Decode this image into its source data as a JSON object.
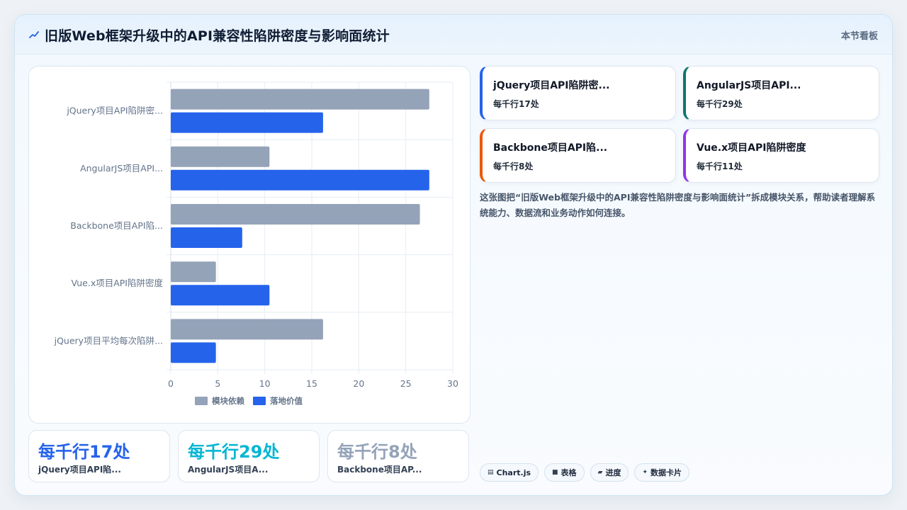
{
  "header": {
    "title": "旧版Web框架升级中的API兼容性陷阱密度与影响面统计",
    "right_label": "本节看板"
  },
  "chart_data": {
    "type": "bar",
    "orientation": "horizontal",
    "categories": [
      "jQuery项目API陷阱密...",
      "AngularJS项目API...",
      "Backbone项目API陷...",
      "Vue.x项目API陷阱密度",
      "jQuery项目平均每次陷阱..."
    ],
    "series": [
      {
        "name": "模块依赖",
        "color": "#94a3b8",
        "values": [
          27.5,
          10.5,
          26.5,
          4.8,
          16.2
        ]
      },
      {
        "name": "落地价值",
        "color": "#2563eb",
        "values": [
          16.2,
          27.5,
          7.6,
          10.5,
          4.8
        ]
      }
    ],
    "xlim": [
      0,
      30
    ],
    "xticks": [
      "0",
      "5",
      "10",
      "15",
      "20",
      "25",
      "30"
    ],
    "grid": true,
    "legend": "bottom"
  },
  "stats": [
    {
      "value": "每千行17处",
      "label": "jQuery项目API陷...",
      "color": "#2563eb"
    },
    {
      "value": "每千行29处",
      "label": "AngularJS项目A...",
      "color": "#06b6d4"
    },
    {
      "value": "每千行8处",
      "label": "Backbone项目AP...",
      "color": "#94a3b8"
    }
  ],
  "cards": [
    {
      "title": "jQuery项目API陷阱密...",
      "sub": "每千行17处",
      "accent": "#2563eb"
    },
    {
      "title": "AngularJS项目API...",
      "sub": "每千行29处",
      "accent": "#0f766e"
    },
    {
      "title": "Backbone项目API陷...",
      "sub": "每千行8处",
      "accent": "#ea580c"
    },
    {
      "title": "Vue.x项目API陷阱密度",
      "sub": "每千行11处",
      "accent": "#9333ea"
    }
  ],
  "description": "这张图把“旧版Web框架升级中的API兼容性陷阱密度与影响面统计”拆成模块关系，帮助读者理解系统能力、数据流和业务动作如何连接。",
  "tags": [
    {
      "icon": "chart-icon",
      "glyph": "▤",
      "label": "Chart.js"
    },
    {
      "icon": "table-icon",
      "glyph": "■",
      "label": "表格"
    },
    {
      "icon": "progress-icon",
      "glyph": "▰",
      "label": "进度"
    },
    {
      "icon": "sparkle-icon",
      "glyph": "✦",
      "label": "数据卡片"
    }
  ]
}
